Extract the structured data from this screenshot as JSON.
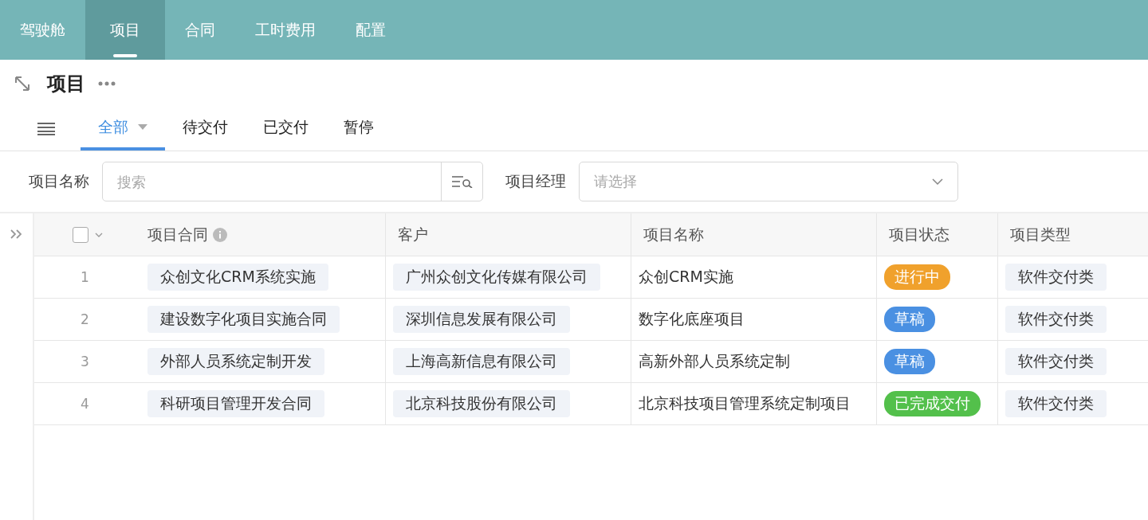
{
  "nav": [
    {
      "label": "驾驶舱",
      "selected": false
    },
    {
      "label": "项目",
      "selected": true
    },
    {
      "label": "合同",
      "selected": false
    },
    {
      "label": "工时费用",
      "selected": false
    },
    {
      "label": "配置",
      "selected": false
    }
  ],
  "page_title": "项目",
  "tabs": [
    {
      "label": "全部",
      "selected": true,
      "dropdown": true
    },
    {
      "label": "待交付",
      "selected": false,
      "dropdown": false
    },
    {
      "label": "已交付",
      "selected": false,
      "dropdown": false
    },
    {
      "label": "暂停",
      "selected": false,
      "dropdown": false
    }
  ],
  "filters": [
    {
      "label": "项目名称",
      "kind": "search",
      "placeholder": "搜索"
    },
    {
      "label": "项目经理",
      "kind": "select",
      "placeholder": "请选择"
    }
  ],
  "table": {
    "select_all_checked": false,
    "columns": [
      {
        "label": "项目合同",
        "info": true
      },
      {
        "label": "客户",
        "info": false
      },
      {
        "label": "项目名称",
        "info": false
      },
      {
        "label": "项目状态",
        "info": false
      },
      {
        "label": "项目类型",
        "info": false
      }
    ],
    "rows": [
      {
        "index": "1",
        "contract": "众创文化CRM系统实施",
        "customer": "广州众创文化传媒有限公司",
        "name": "众创CRM实施",
        "status": "进行中",
        "color": "#f0a12c",
        "type": "软件交付类"
      },
      {
        "index": "2",
        "contract": "建设数字化项目实施合同",
        "customer": "深圳信息发展有限公司",
        "name": "数字化底座项目",
        "status": "草稿",
        "color": "#4a90e2",
        "type": "软件交付类"
      },
      {
        "index": "3",
        "contract": "外部人员系统定制开发",
        "customer": "上海高新信息有限公司",
        "name": "高新外部人员系统定制",
        "status": "草稿",
        "color": "#4a90e2",
        "type": "软件交付类"
      },
      {
        "index": "4",
        "contract": "科研项目管理开发合同",
        "customer": "北京科技股份有限公司",
        "name": "北京科技项目管理系统定制项目",
        "status": "已完成交付",
        "color": "#53c04b",
        "type": "软件交付类"
      }
    ]
  }
}
